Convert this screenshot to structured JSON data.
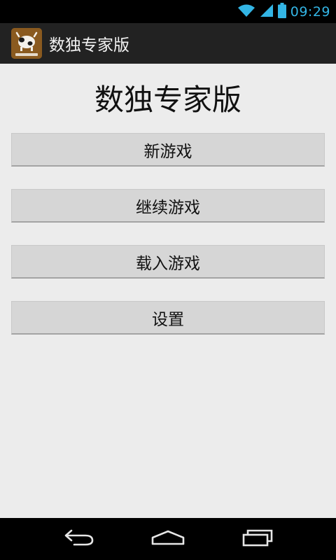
{
  "status_bar": {
    "time": "09:29",
    "icons": [
      "wifi-icon",
      "signal-icon",
      "battery-icon"
    ],
    "time_color": "#33b5e5"
  },
  "action_bar": {
    "app_title": "数独专家版",
    "icon": "sudoku-app-icon"
  },
  "main": {
    "heading": "数独专家版",
    "buttons": [
      {
        "label": "新游戏"
      },
      {
        "label": "继续游戏"
      },
      {
        "label": "载入游戏"
      },
      {
        "label": "设置"
      }
    ]
  },
  "nav_bar": {
    "icons": [
      "back-icon",
      "home-icon",
      "recents-icon"
    ]
  }
}
